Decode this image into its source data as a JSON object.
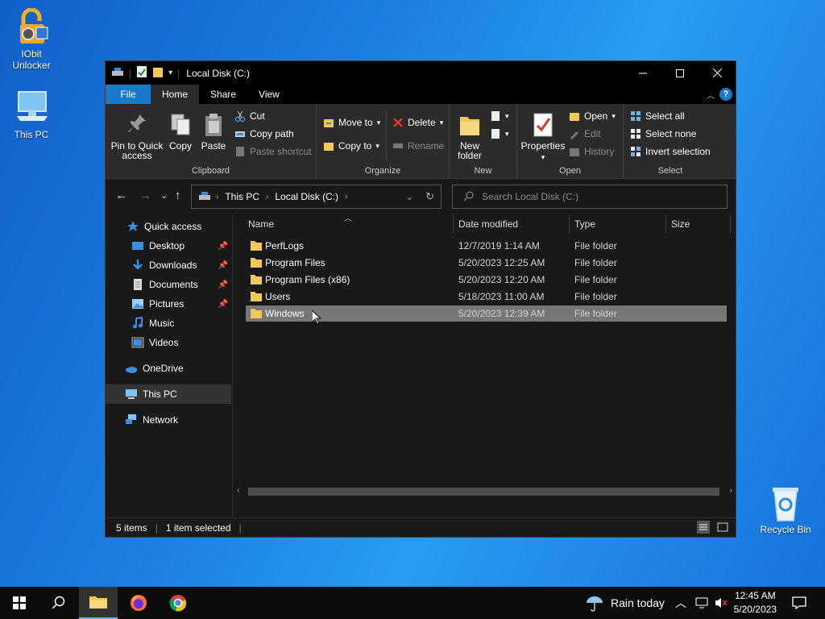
{
  "desktop": {
    "icons": [
      {
        "label": "IObit Unlocker"
      },
      {
        "label": "This PC"
      },
      {
        "label": "Recycle Bin"
      }
    ]
  },
  "window": {
    "title": "Local Disk (C:)",
    "tabs": [
      "File",
      "Home",
      "Share",
      "View"
    ],
    "help": "?"
  },
  "ribbon": {
    "clipboard": {
      "label": "Clipboard",
      "pin": "Pin to Quick access",
      "copy": "Copy",
      "paste": "Paste",
      "cut": "Cut",
      "copy_path": "Copy path",
      "paste_shortcut": "Paste shortcut"
    },
    "organize": {
      "label": "Organize",
      "move_to": "Move to",
      "copy_to": "Copy to",
      "delete": "Delete",
      "rename": "Rename"
    },
    "new": {
      "label": "New",
      "new_folder": "New folder"
    },
    "open": {
      "label": "Open",
      "properties": "Properties",
      "open": "Open",
      "edit": "Edit",
      "history": "History"
    },
    "select": {
      "label": "Select",
      "select_all": "Select all",
      "select_none": "Select none",
      "invert": "Invert selection"
    }
  },
  "address": {
    "crumbs": [
      "This PC",
      "Local Disk (C:)"
    ],
    "search_placeholder": "Search Local Disk (C:)"
  },
  "nav": {
    "items": [
      {
        "label": "Quick access"
      },
      {
        "label": "Desktop"
      },
      {
        "label": "Downloads"
      },
      {
        "label": "Documents"
      },
      {
        "label": "Pictures"
      },
      {
        "label": "Music"
      },
      {
        "label": "Videos"
      },
      {
        "label": "OneDrive"
      },
      {
        "label": "This PC"
      },
      {
        "label": "Network"
      }
    ]
  },
  "files": {
    "columns": [
      "Name",
      "Date modified",
      "Type",
      "Size"
    ],
    "rows": [
      {
        "name": "PerfLogs",
        "date": "12/7/2019 1:14 AM",
        "type": "File folder"
      },
      {
        "name": "Program Files",
        "date": "5/20/2023 12:25 AM",
        "type": "File folder"
      },
      {
        "name": "Program Files (x86)",
        "date": "5/20/2023 12:20 AM",
        "type": "File folder"
      },
      {
        "name": "Users",
        "date": "5/18/2023 11:00 AM",
        "type": "File folder"
      },
      {
        "name": "Windows",
        "date": "5/20/2023 12:39 AM",
        "type": "File folder"
      }
    ]
  },
  "status": {
    "items": "5 items",
    "selected": "1 item selected"
  },
  "taskbar": {
    "weather": "Rain today",
    "time": "12:45 AM",
    "date": "5/20/2023"
  }
}
